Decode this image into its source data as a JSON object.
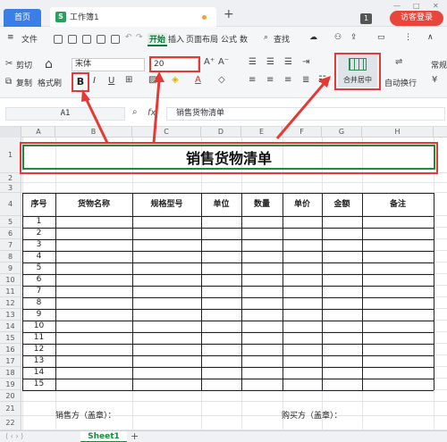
{
  "titlebar": {
    "home_tab": "首页",
    "doc_tab": "工作簿1",
    "new_tab": "+",
    "badge": "1",
    "guest_login": "访客登录"
  },
  "menubar": {
    "file": "文件",
    "tabs": [
      "开始",
      "插入",
      "页面布局",
      "公式",
      "数"
    ],
    "search": "查找"
  },
  "ribbon": {
    "cut": "剪切",
    "copy": "复制",
    "format_painter": "格式刷",
    "font_name": "宋体",
    "font_size": "20",
    "bold": "B",
    "italic": "I",
    "merge_center": "合并居中",
    "wrap": "自动换行",
    "normal": "常规"
  },
  "formula_bar": {
    "cell_ref": "A1",
    "fx": "fx",
    "content": "销售货物清单"
  },
  "columns": [
    "A",
    "B",
    "C",
    "D",
    "E",
    "F",
    "G",
    "H"
  ],
  "rows": [
    "1",
    "2",
    "3",
    "4",
    "5",
    "6",
    "7",
    "8",
    "9",
    "10",
    "11",
    "12",
    "13",
    "14",
    "15",
    "16",
    "17",
    "18",
    "19",
    "20",
    "21",
    "22"
  ],
  "sheet": {
    "title": "销售货物清单",
    "headers": [
      "序号",
      "货物名称",
      "规格型号",
      "单位",
      "数量",
      "单价",
      "金额",
      "备注"
    ],
    "seq": [
      "1",
      "2",
      "3",
      "4",
      "5",
      "6",
      "7",
      "8",
      "9",
      "10",
      "11",
      "12",
      "13",
      "14",
      "15"
    ],
    "seller": "销售方（盖章）：",
    "buyer": "购买方（盖章）："
  },
  "sheetbar": {
    "sheet_name": "Sheet1",
    "add": "+"
  }
}
